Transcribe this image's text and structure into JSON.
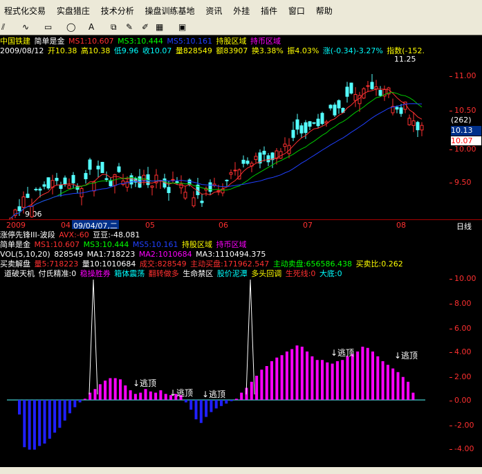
{
  "menu": [
    "程式化交易",
    "实盘猎庄",
    "技术分析",
    "操盘训练基地",
    "资讯",
    "外挂",
    "插件",
    "窗口",
    "帮助"
  ],
  "main_chart": {
    "stock_name": "中国铁建",
    "indicator_name": "简单是金",
    "ms1": "MS1:10.607",
    "ms3": "MS3:10.444",
    "ms5": "MS5:10.161",
    "hold_zone": "持股区域",
    "hold_state": "持币区域",
    "date": "2009/08/12",
    "open": "开10.38",
    "high": "高10.38",
    "low": "低9.96",
    "close": "收10.07",
    "volume": "量828549",
    "amount": "额83907",
    "turnover": "换3.38%",
    "amplitude": "振4.03%",
    "change": "涨(-0.34)-3.27%",
    "index_label": "指数(-152.",
    "peak_label": "11.25",
    "low_label": "9.06",
    "ticks": [
      "11.00",
      "10.50",
      "10.00",
      "9.50"
    ],
    "count_badge": "(262)",
    "price_badge": "10.13",
    "current_price": "10.07",
    "colors": {
      "up": "#ff3030",
      "down": "#54ffff",
      "ms1": "#ff3030",
      "ms3": "#00cc00",
      "ms5": "#2040ff"
    }
  },
  "date_axis": {
    "labels": [
      "2009",
      "04",
      "09/04/07,二",
      "05",
      "06",
      "07",
      "08"
    ],
    "period": "日线"
  },
  "indicators": [
    {
      "name": "涨停先锋III-波段",
      "a": "AVX:-60",
      "b": "豆豆:-48.081"
    },
    {
      "name": "简单是金",
      "a": "MS1:10.607",
      "b": "MS3:10.444",
      "c": "MS5:10.161",
      "d": "持股区域",
      "e": "持币区域"
    },
    {
      "name": "VOL(5,10,20)",
      "a": "828549",
      "b": "MA1:718223",
      "c": "MA2:1010684",
      "d": "MA3:1110494.375"
    },
    {
      "name": "买卖解盘",
      "a": "量5:718223",
      "b": "量10:1010684",
      "c": "成交:828549",
      "d": "主动买盘:171962.547",
      "e": "主动卖盘:656586.438",
      "f": "买卖比:0.262"
    }
  ],
  "bottom_panel": {
    "title": "道破天机",
    "item1": "付氏精准:0",
    "item2": "稳操胜券",
    "item3": "箱体震荡",
    "item4": "翻转做多",
    "item5": "生命禁区",
    "item6": "股价泥潭",
    "item7": "多头回调",
    "item8": "生死线:0",
    "item9": "大底:0",
    "escape_label": "逃顶",
    "ticks": [
      "10.00",
      "8.00",
      "6.00",
      "4.00",
      "2.00",
      "0.00",
      "-2.00",
      "-4.00"
    ]
  },
  "hist_values": [
    -1.2,
    -3.9,
    -4.1,
    -4.1,
    -3.8,
    -3.6,
    -3.2,
    -2.7,
    -2.3,
    -1.7,
    -1.1,
    -0.6,
    -0.2,
    0.1,
    0.6,
    0.9,
    1.3,
    1.6,
    1.8,
    1.8,
    1.7,
    1.2,
    0.8,
    0.5,
    0.6,
    0.9,
    0.7,
    0.6,
    0.8,
    0.5,
    0.4,
    0.5,
    0.4,
    -0.2,
    -0.8,
    -1.6,
    -1.9,
    -1.4,
    -1.0,
    -0.7,
    -0.5,
    -0.3,
    -0.1,
    0.1,
    0.6,
    1.0,
    1.5,
    2.0,
    2.5,
    2.8,
    3.2,
    3.5,
    3.7,
    4.0,
    4.2,
    4.5,
    4.4,
    4.0,
    3.6,
    3.3,
    3.3,
    3.1,
    3.0,
    3.2,
    3.3,
    3.6,
    3.8,
    4.0,
    4.4,
    4.3,
    4.0,
    3.6,
    3.2,
    2.9,
    2.6,
    2.3,
    1.9,
    1.5,
    0.6
  ]
}
